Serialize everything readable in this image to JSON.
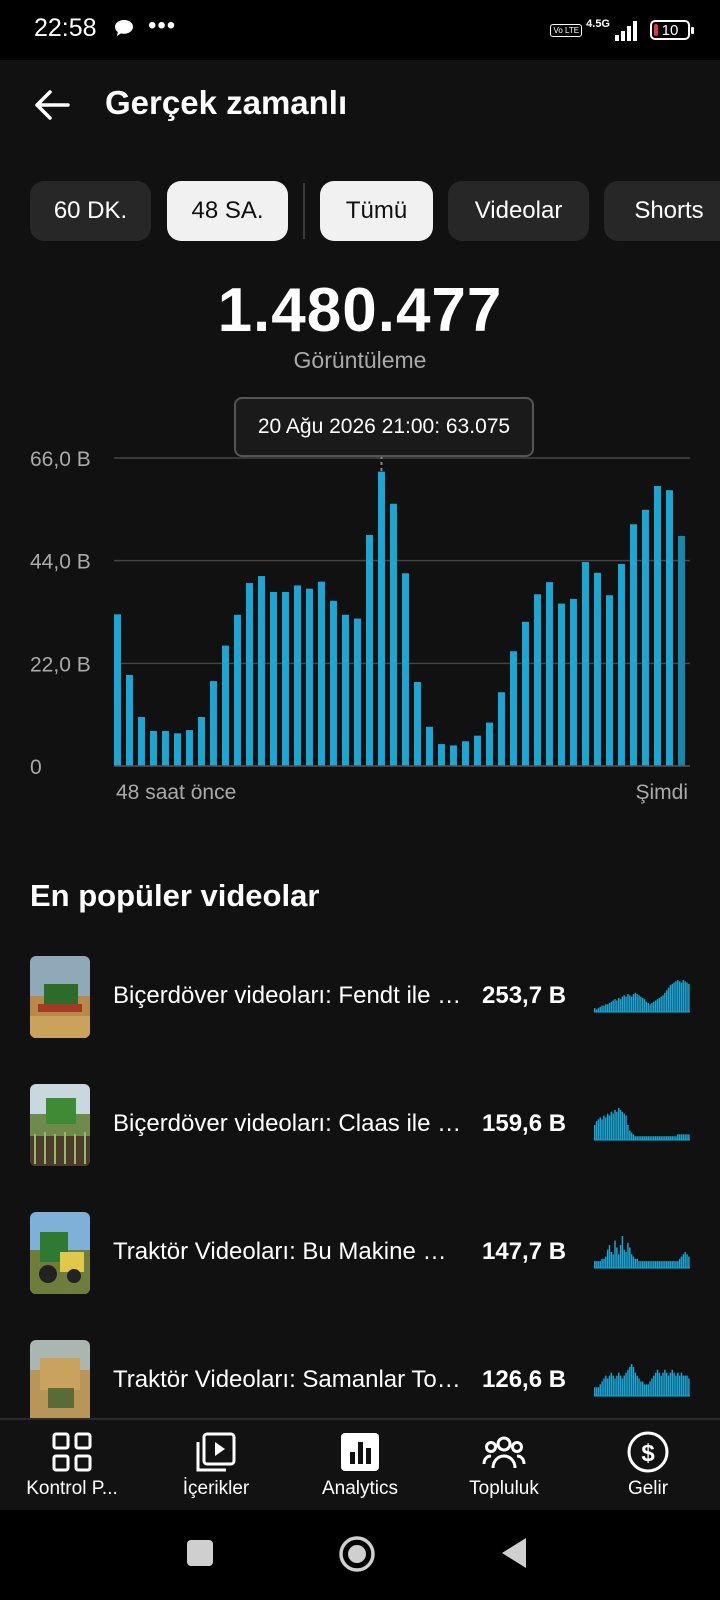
{
  "status_bar": {
    "time": "22:58",
    "dots": "•••",
    "volte": "Vo LTE",
    "network": "4.5G",
    "battery": "10"
  },
  "header": {
    "title": "Gerçek zamanlı",
    "back_icon": "arrow-left-icon"
  },
  "filters": {
    "time_ranges": [
      {
        "label": "60 DK.",
        "selected": false
      },
      {
        "label": "48 SA.",
        "selected": true
      }
    ],
    "content_types": [
      {
        "label": "Tümü",
        "selected": true
      },
      {
        "label": "Videolar",
        "selected": false
      },
      {
        "label": "Shorts",
        "selected": false
      }
    ]
  },
  "summary": {
    "total": "1.480.477",
    "label": "Görüntüleme"
  },
  "tooltip": {
    "text": "20 Ağu 2026 21:00: 63.075"
  },
  "chart_data": {
    "type": "bar",
    "ylabel": "",
    "y_tick_labels": [
      "0",
      "22,0 B",
      "44,0 B",
      "66,0 B"
    ],
    "ylim": [
      0,
      66000
    ],
    "x_start_label": "48 saat önce",
    "x_end_label": "Şimdi",
    "grid": true,
    "values": [
      32500,
      19500,
      10500,
      7500,
      7500,
      7000,
      7700,
      10500,
      18200,
      25800,
      32400,
      39200,
      40700,
      37300,
      37300,
      38700,
      38000,
      39500,
      35400,
      32400,
      31600,
      49500,
      63075,
      56200,
      41300,
      18000,
      8400,
      4700,
      4400,
      5300,
      6500,
      9300,
      15800,
      24600,
      30900,
      36800,
      39400,
      34800,
      35800,
      43700,
      41400,
      36600,
      43300,
      51800,
      54900,
      60000,
      59100,
      49300
    ],
    "highlight_index": 22,
    "bar_color": "#1aa7d6"
  },
  "top_videos": {
    "title": "En popüler videolar",
    "items": [
      {
        "title": "Biçerdöver videoları: Fendt ile Buğday Hasadı",
        "views": "253,7 B",
        "spark": [
          3,
          2,
          3,
          4,
          5,
          5,
          6,
          6,
          7,
          8,
          9,
          10,
          9,
          11,
          10,
          12,
          13,
          12,
          14,
          13,
          12,
          14,
          15,
          14,
          13,
          12,
          11,
          10,
          8,
          7,
          6,
          7,
          8,
          9,
          10,
          11,
          12,
          13,
          15,
          17,
          19,
          21,
          22,
          23,
          24,
          25,
          24,
          23,
          25,
          24,
          23,
          22
        ]
      },
      {
        "title": "Biçerdöver videoları: Claas ile Mısır Hasadı",
        "views": "159,6 B",
        "spark": [
          8,
          10,
          11,
          12,
          11,
          13,
          12,
          14,
          13,
          15,
          14,
          16,
          15,
          17,
          16,
          15,
          14,
          13,
          8,
          5,
          4,
          3,
          2,
          2,
          2,
          2,
          2,
          2,
          2,
          2,
          2,
          2,
          2,
          2,
          2,
          2,
          2,
          2,
          2,
          2,
          2,
          2,
          2,
          2,
          2,
          3,
          3,
          3,
          3,
          3,
          3,
          3
        ]
      },
      {
        "title": "Traktör Videoları: Bu Makine Çok Güçlü",
        "views": "147,7 B",
        "spark": [
          3,
          3,
          3,
          3,
          4,
          4,
          5,
          8,
          10,
          7,
          6,
          12,
          9,
          6,
          10,
          14,
          8,
          7,
          11,
          9,
          6,
          5,
          4,
          4,
          3,
          3,
          3,
          3,
          3,
          3,
          3,
          3,
          3,
          3,
          3,
          3,
          3,
          3,
          3,
          3,
          3,
          3,
          3,
          3,
          3,
          3,
          4,
          5,
          6,
          7,
          6,
          5
        ]
      },
      {
        "title": "Traktör Videoları: Samanlar Toplanıyor",
        "views": "126,6 B",
        "spark": [
          3,
          3,
          3,
          4,
          5,
          6,
          7,
          6,
          7,
          8,
          7,
          6,
          7,
          8,
          7,
          6,
          7,
          8,
          9,
          10,
          11,
          10,
          8,
          7,
          6,
          5,
          5,
          4,
          4,
          4,
          5,
          6,
          7,
          8,
          9,
          8,
          7,
          8,
          9,
          8,
          7,
          8,
          9,
          8,
          7,
          8,
          7,
          8,
          7,
          7,
          7,
          6
        ]
      }
    ]
  },
  "bottom_nav": [
    {
      "label": "Kontrol P...",
      "icon": "dashboard-icon"
    },
    {
      "label": "İçerikler",
      "icon": "content-icon"
    },
    {
      "label": "Analytics",
      "icon": "analytics-icon"
    },
    {
      "label": "Topluluk",
      "icon": "community-icon"
    },
    {
      "label": "Gelir",
      "icon": "earn-icon"
    }
  ]
}
